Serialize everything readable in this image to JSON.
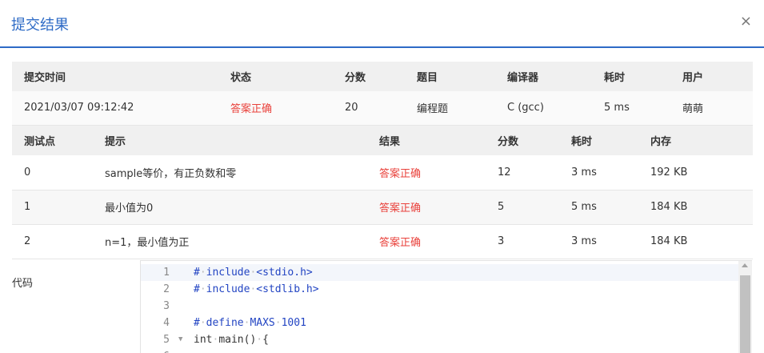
{
  "dialog": {
    "title": "提交结果",
    "close_glyph": "×"
  },
  "submission": {
    "headers": [
      "提交时间",
      "状态",
      "分数",
      "题目",
      "编译器",
      "耗时",
      "用户"
    ],
    "row": {
      "time": "2021/03/07 09:12:42",
      "status": "答案正确",
      "score": "20",
      "problem": "编程题",
      "compiler": "C (gcc)",
      "elapsed": "5 ms",
      "user": "萌萌"
    }
  },
  "tests": {
    "headers": [
      "测试点",
      "提示",
      "结果",
      "分数",
      "耗时",
      "内存"
    ],
    "rows": [
      {
        "id": "0",
        "hint": "sample等价，有正负数和零",
        "result": "答案正确",
        "score": "12",
        "time": "3 ms",
        "memory": "192 KB"
      },
      {
        "id": "1",
        "hint": "最小值为0",
        "result": "答案正确",
        "score": "5",
        "time": "5 ms",
        "memory": "184 KB"
      },
      {
        "id": "2",
        "hint": "n=1，最小值为正",
        "result": "答案正确",
        "score": "3",
        "time": "3 ms",
        "memory": "184 KB"
      }
    ]
  },
  "code": {
    "label": "代码",
    "lines": [
      {
        "n": "1",
        "text": "#·include·<stdio.h>"
      },
      {
        "n": "2",
        "text": "#·include·<stdlib.h>"
      },
      {
        "n": "3",
        "text": ""
      },
      {
        "n": "4",
        "text": "#·define·MAXS·1001"
      },
      {
        "n": "5",
        "text": "int·main()·{"
      }
    ]
  },
  "colors": {
    "accent": "#2e6bc6",
    "success": "#e9423c"
  }
}
